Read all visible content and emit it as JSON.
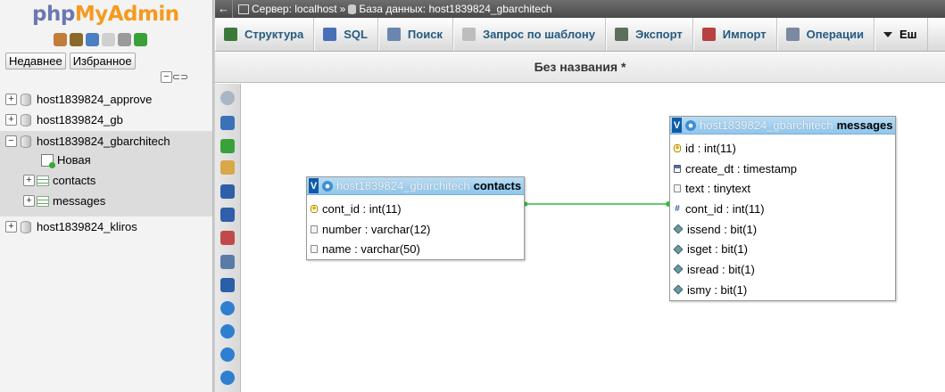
{
  "nav": {
    "logo_php": "php",
    "logo_myadmin": "MyAdmin",
    "tabs": [
      "Недавнее",
      "Избранное"
    ],
    "collapse_symbol": "−",
    "link_symbol": "⊂⊃",
    "databases": [
      {
        "name": "host1839824_approve",
        "expander": "+"
      },
      {
        "name": "host1839824_gb",
        "expander": "+"
      },
      {
        "name": "host1839824_gbarchitech",
        "expander": "−"
      },
      {
        "name": "host1839824_kliros",
        "expander": "+"
      }
    ],
    "children": {
      "new_label": "Новая",
      "tables": [
        {
          "name": "contacts",
          "expander": "+"
        },
        {
          "name": "messages",
          "expander": "+"
        }
      ]
    },
    "icon_colors": [
      "#c27d3a",
      "#8a6a2a",
      "#4a7fc0",
      "#d0d0d0",
      "#9a9a9a",
      "#3aa03a"
    ]
  },
  "topbar": {
    "back_arrow": "←",
    "server_label": "Сервер: localhost",
    "separator": "»",
    "database_label": "База данных: host1839824_gbarchitech"
  },
  "menu": {
    "tabs": [
      {
        "label": "Структура",
        "icon": "structure-icon",
        "color": "#3c7a3c"
      },
      {
        "label": "SQL",
        "icon": "sql-icon",
        "color": "#4a6fb8"
      },
      {
        "label": "Поиск",
        "icon": "search-icon",
        "color": "#6a86b0"
      },
      {
        "label": "Запрос по шаблону",
        "icon": "query-icon",
        "color": "#bdbdbd"
      },
      {
        "label": "Экспорт",
        "icon": "export-icon",
        "color": "#5c6f5c"
      },
      {
        "label": "Импорт",
        "icon": "import-icon",
        "color": "#b84040"
      },
      {
        "label": "Операции",
        "icon": "wrench-icon",
        "color": "#7a8aa0"
      },
      {
        "label": "Еш",
        "icon": "dropdown-icon",
        "color": "#333333"
      }
    ]
  },
  "designer": {
    "title": "Без названия *",
    "tools": [
      {
        "name": "toggle-panel-tool",
        "color": "#a9b6c4",
        "round": true
      },
      {
        "name": "fullscreen-tool",
        "color": "#3a72b8",
        "round": false
      },
      {
        "name": "add-tables-tool",
        "color": "#3aa03a",
        "round": false
      },
      {
        "name": "edit-tool",
        "color": "#d8a84a",
        "round": false
      },
      {
        "name": "save-tool",
        "color": "#2f5fa8",
        "round": false
      },
      {
        "name": "save-as-tool",
        "color": "#2f5fa8",
        "round": false
      },
      {
        "name": "delete-page-tool",
        "color": "#c04a4a",
        "round": false
      },
      {
        "name": "list-tool",
        "color": "#5a7aa8",
        "round": false
      },
      {
        "name": "relation-line-tool",
        "color": "#2a5fa8",
        "round": false
      },
      {
        "name": "angular-links-tool",
        "color": "#2f7fd0",
        "round": true
      },
      {
        "name": "refresh-tool",
        "color": "#2f7fd0",
        "round": true
      },
      {
        "name": "help-tool",
        "color": "#2f7fd0",
        "round": true
      },
      {
        "name": "export-schema-tool",
        "color": "#2f7fd0",
        "round": true
      }
    ],
    "tables": [
      {
        "db": "host1839824_gbarchitech",
        "name": "contacts",
        "toggle": "V",
        "fields": [
          {
            "label": "cont_id : int(11)",
            "icon": "key"
          },
          {
            "label": "number : varchar(12)",
            "icon": "txt"
          },
          {
            "label": "name : varchar(50)",
            "icon": "txt"
          }
        ]
      },
      {
        "db": "host1839824_gbarchitech",
        "name": "messages",
        "toggle": "V",
        "fields": [
          {
            "label": "id : int(11)",
            "icon": "key"
          },
          {
            "label": "create_dt : timestamp",
            "icon": "date"
          },
          {
            "label": "text : tinytext",
            "icon": "txt"
          },
          {
            "label": "cont_id : int(11)",
            "icon": "num"
          },
          {
            "label": "issend : bit(1)",
            "icon": "bit"
          },
          {
            "label": "isget : bit(1)",
            "icon": "bit"
          },
          {
            "label": "isread : bit(1)",
            "icon": "bit"
          },
          {
            "label": "ismy : bit(1)",
            "icon": "bit"
          }
        ]
      }
    ],
    "relation_color": "#2fbf3f",
    "num_glyph": "#"
  }
}
